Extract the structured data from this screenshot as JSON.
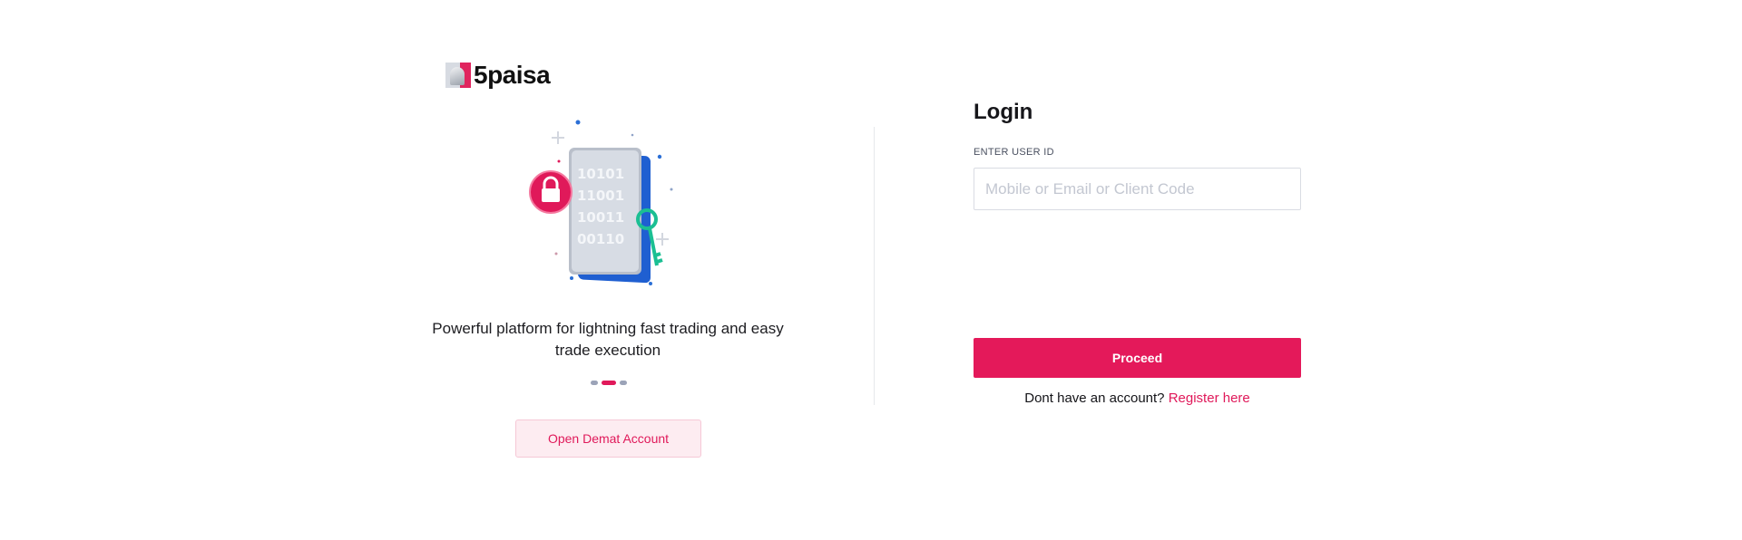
{
  "brand": {
    "name": "5paisa",
    "accent_color": "#e4195a"
  },
  "carousel": {
    "tagline": "Powerful platform for lightning fast trading and easy trade execution",
    "active_slide": 2,
    "slide_count": 3,
    "illustration_rows": [
      "10101",
      "11001",
      "10011",
      "00110"
    ]
  },
  "left": {
    "demat_button": "Open Demat Account"
  },
  "login": {
    "title": "Login",
    "user_id_label": "ENTER USER ID",
    "user_id_placeholder": "Mobile or Email or Client Code",
    "user_id_value": "",
    "proceed_button": "Proceed",
    "register_prompt": "Dont have an account?",
    "register_link": "Register here"
  },
  "icons": {
    "logo": "5paisa-logo-icon",
    "illustration": "secure-data-lock-key-illustration"
  }
}
